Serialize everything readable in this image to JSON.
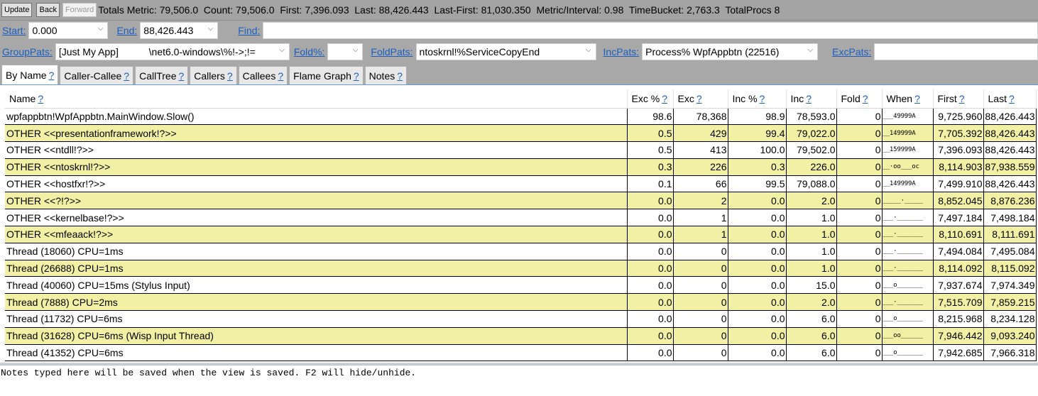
{
  "toolbar": {
    "update_label": "Update",
    "back_label": "Back",
    "forward_label": "Forward",
    "totals": "Totals Metric: 79,506.0  Count: 79,506.0  First: 7,396.093  Last: 88,426.443  Last-First: 81,030.350  Metric/Interval: 0.98  TimeBucket: 2,763.3  TotalProcs 8"
  },
  "range": {
    "start_label": "Start:",
    "start_value": "0.000",
    "end_label": "End:",
    "end_value": "88,426.443",
    "find_label": "Find:",
    "find_value": ""
  },
  "filters": {
    "grouppats_label": "GroupPats:",
    "grouppats_value": "[Just My App]           \\net6.0-windows\\%!->;!=",
    "foldpct_label": "Fold%:",
    "foldpct_value": "",
    "foldpats_label": "FoldPats:",
    "foldpats_value": "ntoskrnl!%ServiceCopyEnd",
    "incpats_label": "IncPats:",
    "incpats_value": "Process% WpfAppbtn (22516)",
    "excpats_label": "ExcPats:",
    "excpats_value": ""
  },
  "tabs": [
    {
      "label": "By Name",
      "help": "?",
      "active": true
    },
    {
      "label": "Caller-Callee",
      "help": "?"
    },
    {
      "label": "CallTree",
      "help": "?"
    },
    {
      "label": "Callers",
      "help": "?"
    },
    {
      "label": "Callees",
      "help": "?"
    },
    {
      "label": "Flame Graph",
      "help": "?"
    },
    {
      "label": "Notes",
      "help": "?"
    }
  ],
  "grid": {
    "columns": [
      {
        "label": "Name",
        "help": "?"
      },
      {
        "label": "Exc %",
        "help": "?"
      },
      {
        "label": "Exc",
        "help": "?"
      },
      {
        "label": "Inc %",
        "help": "?"
      },
      {
        "label": "Inc",
        "help": "?"
      },
      {
        "label": "Fold",
        "help": "?"
      },
      {
        "label": "When",
        "help": "?"
      },
      {
        "label": "First",
        "help": "?"
      },
      {
        "label": "Last",
        "help": "?"
      }
    ],
    "rows": [
      {
        "name": "wpfappbtn!WpfAppbtn.MainWindow.Slow()",
        "exc_pct": "98.6",
        "exc": "78,368",
        "inc_pct": "98.9",
        "inc": "78,593.0",
        "fold": "0",
        "when": "___49999A",
        "first": "9,725.960",
        "last": "88,426.443"
      },
      {
        "name": "OTHER <<presentationframework!?>>",
        "exc_pct": "0.5",
        "exc": "429",
        "inc_pct": "99.4",
        "inc": "79,022.0",
        "fold": "0",
        "when": "__149999A",
        "first": "7,705.392",
        "last": "88,426.443"
      },
      {
        "name": "OTHER <<ntdll!?>>",
        "exc_pct": "0.5",
        "exc": "413",
        "inc_pct": "100.0",
        "inc": "79,502.0",
        "fold": "0",
        "when": "__159999A",
        "first": "7,396.093",
        "last": "88,426.443"
      },
      {
        "name": "OTHER <<ntoskrnl!?>>",
        "exc_pct": "0.3",
        "exc": "226",
        "inc_pct": "0.3",
        "inc": "226.0",
        "fold": "0",
        "when": "__·oo___oc",
        "first": "8,114.903",
        "last": "87,938.559"
      },
      {
        "name": "OTHER <<hostfxr!?>>",
        "exc_pct": "0.1",
        "exc": "66",
        "inc_pct": "99.5",
        "inc": "79,088.0",
        "fold": "0",
        "when": "__149999A",
        "first": "7,499.910",
        "last": "88,426.443"
      },
      {
        "name": "OTHER <<?!?>>",
        "exc_pct": "0.0",
        "exc": "2",
        "inc_pct": "0.0",
        "inc": "2.0",
        "fold": "0",
        "when": "_____·_____",
        "first": "8,852.045",
        "last": "8,876.236"
      },
      {
        "name": "OTHER <<kernelbase!?>>",
        "exc_pct": "0.0",
        "exc": "1",
        "inc_pct": "0.0",
        "inc": "1.0",
        "fold": "0",
        "when": "___·_______",
        "first": "7,497.184",
        "last": "7,498.184"
      },
      {
        "name": "OTHER <<mfeaack!?>>",
        "exc_pct": "0.0",
        "exc": "1",
        "inc_pct": "0.0",
        "inc": "1.0",
        "fold": "0",
        "when": "___·_______",
        "first": "8,110.691",
        "last": "8,111.691"
      },
      {
        "name": "Thread (18060) CPU=1ms",
        "exc_pct": "0.0",
        "exc": "0",
        "inc_pct": "0.0",
        "inc": "1.0",
        "fold": "0",
        "when": "___·_______",
        "first": "7,494.084",
        "last": "7,495.084"
      },
      {
        "name": "Thread (26688) CPU=1ms",
        "exc_pct": "0.0",
        "exc": "0",
        "inc_pct": "0.0",
        "inc": "1.0",
        "fold": "0",
        "when": "___·_______",
        "first": "8,114.092",
        "last": "8,115.092"
      },
      {
        "name": "Thread (40060) CPU=15ms (Stylus Input)",
        "exc_pct": "0.0",
        "exc": "0",
        "inc_pct": "0.0",
        "inc": "15.0",
        "fold": "0",
        "when": "___o_______",
        "first": "7,937.674",
        "last": "7,974.349"
      },
      {
        "name": "Thread (7888) CPU=2ms",
        "exc_pct": "0.0",
        "exc": "0",
        "inc_pct": "0.0",
        "inc": "2.0",
        "fold": "0",
        "when": "___·_______",
        "first": "7,515.709",
        "last": "7,859.215"
      },
      {
        "name": "Thread (11732) CPU=6ms",
        "exc_pct": "0.0",
        "exc": "0",
        "inc_pct": "0.0",
        "inc": "6.0",
        "fold": "0",
        "when": "___o_______",
        "first": "8,215.968",
        "last": "8,234.128"
      },
      {
        "name": "Thread (31628) CPU=6ms (Wisp Input Thread)",
        "exc_pct": "0.0",
        "exc": "0",
        "inc_pct": "0.0",
        "inc": "6.0",
        "fold": "0",
        "when": "___oo______",
        "first": "7,946.442",
        "last": "9,093.240"
      },
      {
        "name": "Thread (41352) CPU=6ms",
        "exc_pct": "0.0",
        "exc": "0",
        "inc_pct": "0.0",
        "inc": "6.0",
        "fold": "0",
        "when": "___o_______",
        "first": "7,942.685",
        "last": "7,966.318"
      }
    ]
  },
  "notes": {
    "text": "Notes typed here will be saved when the view is saved. F2 will hide/unhide."
  }
}
